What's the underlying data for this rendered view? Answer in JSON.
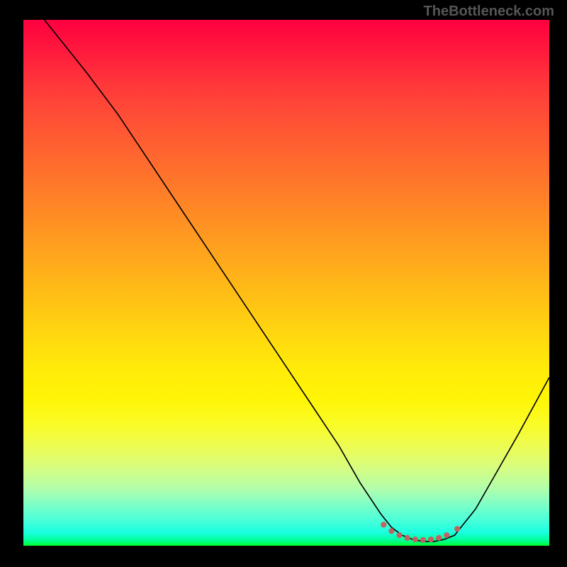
{
  "watermark": "TheBottleneck.com",
  "chart_data": {
    "type": "line",
    "title": "",
    "xlabel": "",
    "ylabel": "",
    "xlim": [
      0,
      100
    ],
    "ylim": [
      0,
      100
    ],
    "curve": {
      "x": [
        4,
        8,
        12,
        18,
        24,
        30,
        36,
        42,
        48,
        54,
        60,
        64,
        68,
        70,
        72,
        74,
        76,
        78,
        80,
        82,
        86,
        90,
        94,
        100
      ],
      "y": [
        100,
        95,
        90,
        82,
        73,
        64,
        55,
        46,
        37,
        28,
        19,
        12,
        6,
        3.5,
        2,
        1.2,
        0.8,
        0.8,
        1.2,
        2,
        7,
        14,
        21,
        32
      ]
    },
    "flat_region_markers": {
      "x": [
        68.5,
        70,
        71.5,
        73,
        74.5,
        76,
        77.5,
        79,
        80.5,
        82.5
      ],
      "y": [
        4.0,
        2.8,
        2.0,
        1.5,
        1.2,
        1.1,
        1.2,
        1.5,
        2.0,
        3.2
      ]
    },
    "colors": {
      "curve": "#000000",
      "markers": "#c46060",
      "background_top": "#ff0040",
      "background_bottom": "#00ff30"
    }
  }
}
